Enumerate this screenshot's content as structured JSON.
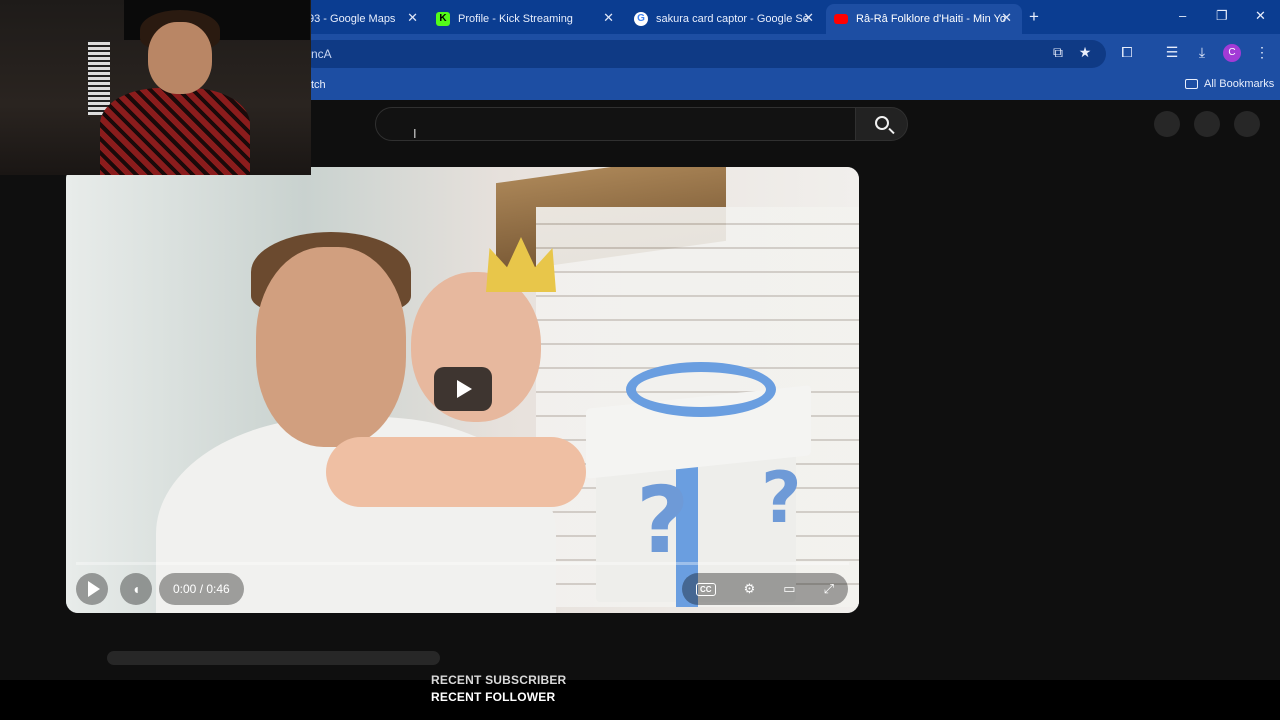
{
  "browser": {
    "tabs": [
      {
        "label": "93 - Google Maps",
        "favicon": "google-maps-favicon"
      },
      {
        "label": "Profile - Kick Streaming",
        "favicon": "kick-favicon"
      },
      {
        "label": "sakura card captor - Google Se",
        "favicon": "google-favicon"
      },
      {
        "label": "Râ-Râ Folklore d'Haiti - Min Yo",
        "favicon": "youtube-favicon"
      }
    ],
    "new_tab": "+",
    "window_controls": {
      "minimize": "–",
      "restore": "❐",
      "close": "✕"
    },
    "address_fragment": "ncA",
    "bookmark_fragment": "tch",
    "all_bookmarks": "All Bookmarks",
    "profile_initial": "C",
    "accent": "#1d4ea3"
  },
  "youtube": {
    "player": {
      "time": "0:00 / 0:46",
      "progress_fraction": 0
    }
  },
  "overlay": {
    "recent_subscriber": "RECENT SUBSCRIBER",
    "recent_follower": "RECENT FOLLOWER"
  }
}
